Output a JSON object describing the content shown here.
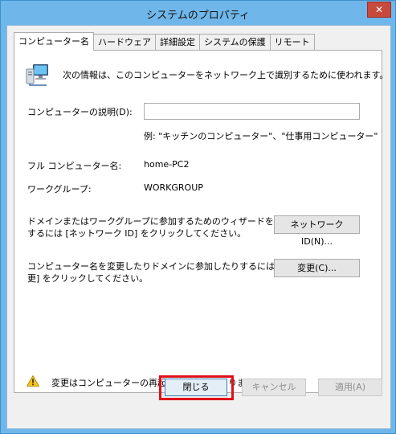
{
  "window": {
    "title": "システムのプロパティ",
    "close_glyph": "✕"
  },
  "tabs": [
    {
      "label": "コンピューター名",
      "active": true
    },
    {
      "label": "ハードウェア",
      "active": false
    },
    {
      "label": "詳細設定",
      "active": false
    },
    {
      "label": "システムの保護",
      "active": false
    },
    {
      "label": "リモート",
      "active": false
    }
  ],
  "panel": {
    "intro": "次の情報は、このコンピューターをネットワーク上で識別するために使われます。",
    "description_label": "コンピューターの説明(D):",
    "description_value": "",
    "example": "例: \"キッチンのコンピューター\"、\"仕事用コンピューター\"",
    "full_name_label": "フル コンピューター名:",
    "full_name_value": "home-PC2",
    "workgroup_label": "ワークグループ:",
    "workgroup_value": "WORKGROUP",
    "network_text_1": "ドメインまたはワークグループに参加するためのウィザードを使用",
    "network_text_2": "するには [ネットワーク ID] をクリックしてください。",
    "network_button": "ネットワーク ID(N)...",
    "change_text_1": "コンピューター名を変更したりドメインに参加したりするには [変",
    "change_text_2": "更] をクリックしてください。",
    "change_button": "変更(C)...",
    "warning_text": "変更はコンピューターの再起動後に有効になります。"
  },
  "footer": {
    "close_button": "閉じる",
    "cancel_button": "キャンセル",
    "apply_button": "適用(A)"
  },
  "colors": {
    "titlebar": "#6fb7ea",
    "close_button": "#c74a3c",
    "highlight": "#e0101a"
  },
  "icons": [
    "computer-network-icon",
    "warning-icon",
    "close-icon"
  ]
}
